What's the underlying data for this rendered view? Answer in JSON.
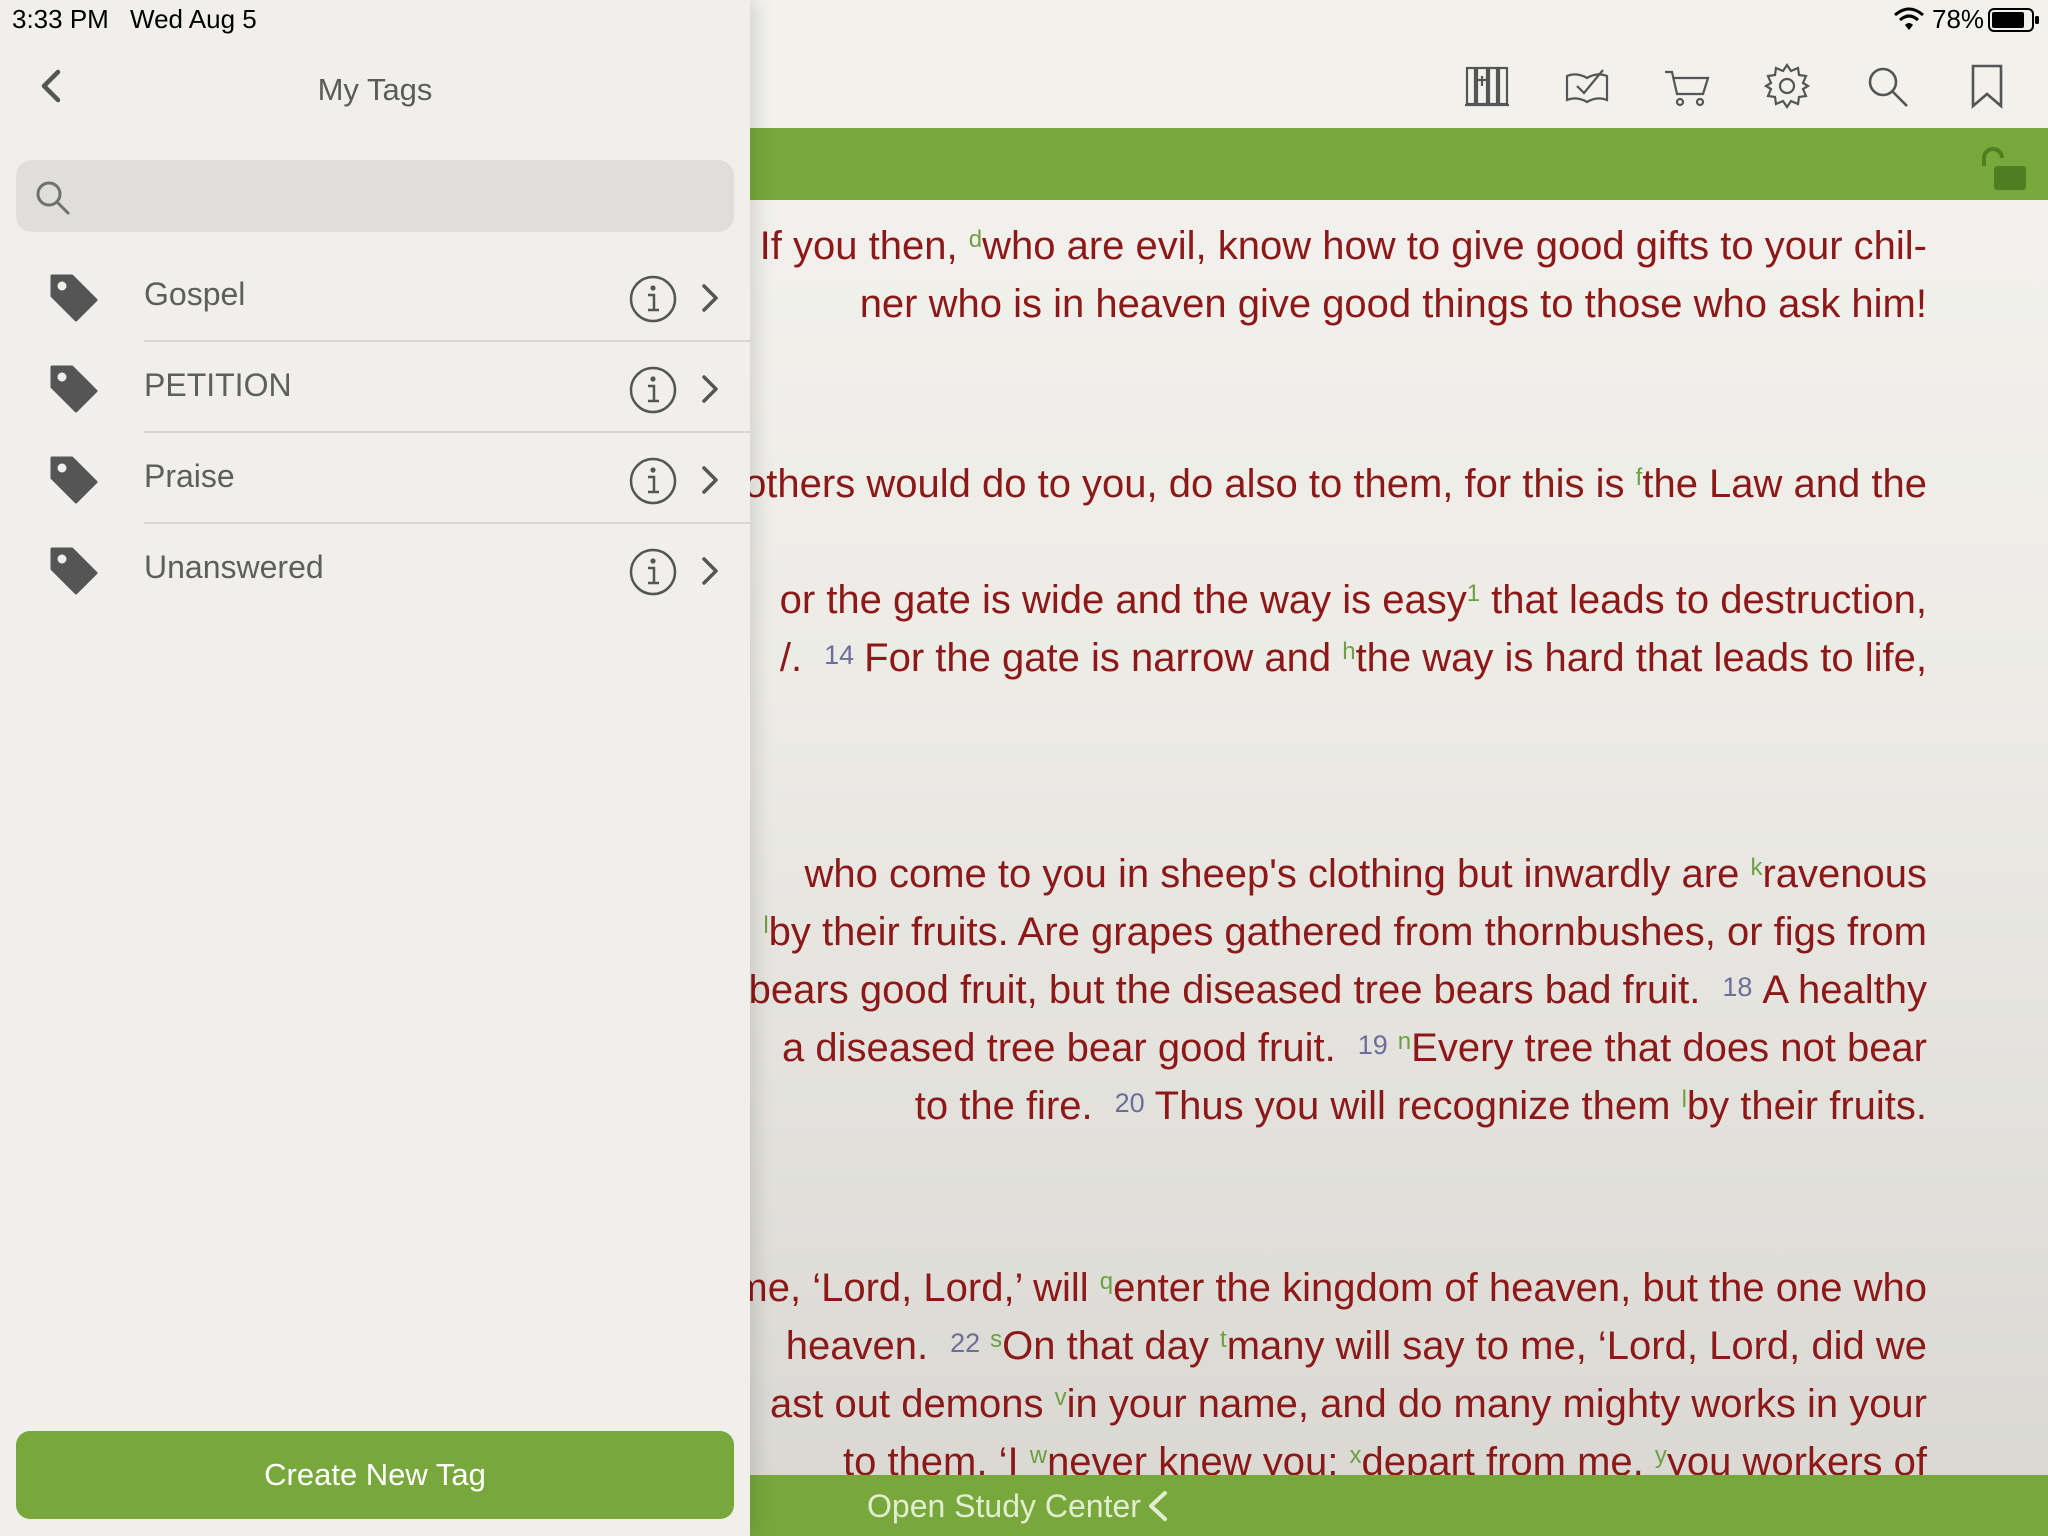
{
  "status_bar": {
    "time": "3:33 PM",
    "date": "Wed Aug 5",
    "battery": "78%"
  },
  "panel": {
    "title": "My Tags",
    "search_placeholder": "",
    "tags": [
      {
        "label": "Gospel"
      },
      {
        "label": "PETITION"
      },
      {
        "label": "Praise"
      },
      {
        "label": "Unanswered"
      }
    ],
    "create_button": "Create New Tag"
  },
  "toolbar": {
    "icons": [
      "library-icon",
      "reading-plan-icon",
      "cart-icon",
      "settings-icon",
      "search-icon",
      "bookmark-icon"
    ]
  },
  "scripture": {
    "lines": [
      {
        "segments": [
          {
            "t": "·  If you then, "
          },
          {
            "sup": "d"
          },
          {
            "t": "who are evil, know how to give good gifts to your chil-"
          }
        ]
      },
      {
        "segments": [
          {
            "t": "ner who is in heaven give good things to those who ask him!"
          }
        ]
      },
      {
        "segments": [
          {
            "t": "others would do to you, do also to them, for this is "
          },
          {
            "sup": "f"
          },
          {
            "t": "the Law and the"
          }
        ]
      },
      {
        "segments": [
          {
            "t": "or the gate is wide and the way is easy"
          },
          {
            "sup": "1"
          },
          {
            "t": " that leads to destruction,"
          }
        ]
      },
      {
        "segments": [
          {
            "t": "/."
          },
          {
            "vn": "14"
          },
          {
            "t": "For the gate is narrow and "
          },
          {
            "sup": "h"
          },
          {
            "t": "the way is hard that leads to life,"
          }
        ]
      },
      {
        "segments": [
          {
            "t": "who come to you in sheep's clothing but inwardly are "
          },
          {
            "sup": "k"
          },
          {
            "t": "ravenous"
          }
        ]
      },
      {
        "segments": [
          {
            "sup": "l"
          },
          {
            "t": "by their fruits. Are grapes gathered from thornbushes, or figs from"
          }
        ]
      },
      {
        "segments": [
          {
            "t": "bears good fruit, but the diseased tree bears bad fruit."
          },
          {
            "vn": "18"
          },
          {
            "t": "A healthy"
          }
        ]
      },
      {
        "segments": [
          {
            "t": "a diseased tree bear good fruit."
          },
          {
            "vn": "19"
          },
          {
            "sup": "n"
          },
          {
            "t": "Every tree that does not bear"
          }
        ]
      },
      {
        "segments": [
          {
            "t": "to the fire."
          },
          {
            "vn": "20"
          },
          {
            "t": "Thus you will recognize them "
          },
          {
            "sup": "l"
          },
          {
            "t": "by their fruits."
          }
        ]
      },
      {
        "segments": [
          {
            "t": "me, ‘Lord, Lord,’ will "
          },
          {
            "sup": "q"
          },
          {
            "t": "enter the kingdom of heaven, but the one who"
          }
        ]
      },
      {
        "segments": [
          {
            "t": "heaven."
          },
          {
            "vn": "22"
          },
          {
            "sup": "s"
          },
          {
            "t": "On that day "
          },
          {
            "sup": "t"
          },
          {
            "t": "many will say to me, ‘Lord, Lord, did we"
          }
        ]
      },
      {
        "segments": [
          {
            "t": "ast out demons "
          },
          {
            "sup": "v"
          },
          {
            "t": "in your name, and do many mighty works in your"
          }
        ]
      },
      {
        "segments": [
          {
            "t": "to them, ‘I "
          },
          {
            "sup": "w"
          },
          {
            "t": "never knew you; "
          },
          {
            "sup": "x"
          },
          {
            "t": "depart from me, "
          },
          {
            "sup": "y"
          },
          {
            "t": "you workers of"
          }
        ]
      }
    ]
  },
  "study_bar": {
    "label": "Open Study Center"
  },
  "colors": {
    "accent_green": "#78a83b",
    "scripture_red": "#8c1818",
    "footnote_green": "#6ea040",
    "verse_number": "#6c6e9a"
  }
}
